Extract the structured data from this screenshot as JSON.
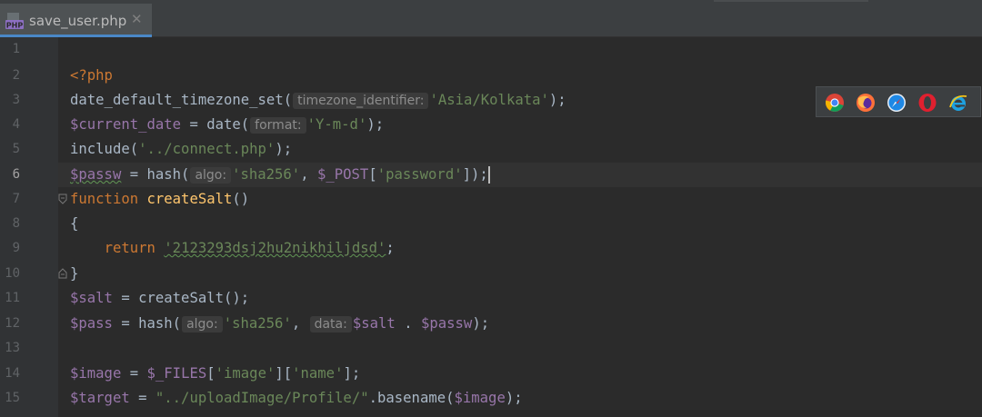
{
  "tab": {
    "filename": "save_user.php",
    "icon_label": "PHP",
    "close_glyph": "✕"
  },
  "gutter": {
    "line_numbers": [
      "1",
      "2",
      "3",
      "4",
      "5",
      "6",
      "7",
      "8",
      "9",
      "10",
      "11",
      "12",
      "13",
      "14",
      "15"
    ],
    "current_line": "6"
  },
  "code": {
    "l2_open": "<?php",
    "l3_fn": "date_default_timezone_set(",
    "l3_hint": "timezone_identifier:",
    "l3_str": "'Asia/Kolkata'",
    "l3_end": ");",
    "l4_var": "$current_date",
    "l4_eq": " = date(",
    "l4_hint": "format:",
    "l4_str": "'Y-m-d'",
    "l4_end": ");",
    "l5_fn": "include(",
    "l5_str": "'../connect.php'",
    "l5_end": ");",
    "l6_var": "$passw",
    "l6_eq": " = hash(",
    "l6_hint": "algo:",
    "l6_str": "'sha256'",
    "l6_comma": ", ",
    "l6_post": "$_POST",
    "l6_br1": "[",
    "l6_key": "'password'",
    "l6_end": "]);",
    "l7_kw": "function",
    "l7_name": "createSalt",
    "l7_end": "()",
    "l8": "{",
    "l9_kw": "return",
    "l9_str": "'2123293dsj2hu2nikhiljdsd'",
    "l9_end": ";",
    "l10": "}",
    "l11_var": "$salt",
    "l11_rest": " = createSalt();",
    "l12_var": "$pass",
    "l12_eq": " = hash(",
    "l12_hint": "algo:",
    "l12_str": "'sha256'",
    "l12_comma": ", ",
    "l12_hint2": "data:",
    "l12_var2": "$salt",
    "l12_dot": " . ",
    "l12_var3": "$passw",
    "l12_end": ");",
    "l14_var": "$image",
    "l14_eq": " = ",
    "l14_files": "$_FILES",
    "l14_b1": "[",
    "l14_key1": "'image'",
    "l14_b2": "][",
    "l14_key2": "'name'",
    "l14_end": "];",
    "l15_var": "$target",
    "l15_eq": " = ",
    "l15_str": "\"../uploadImage/Profile/\"",
    "l15_dot": ".basename(",
    "l15_var2": "$image",
    "l15_end": ");"
  },
  "browsers": [
    "chrome-icon",
    "firefox-icon",
    "safari-icon",
    "opera-icon",
    "ie-icon"
  ],
  "colors": {
    "keyword": "#cc7832",
    "string": "#6a8759",
    "variable": "#9876aa",
    "function_name": "#ffc66d",
    "default_text": "#a9b7c6",
    "tab_underline": "#4a88c7"
  }
}
